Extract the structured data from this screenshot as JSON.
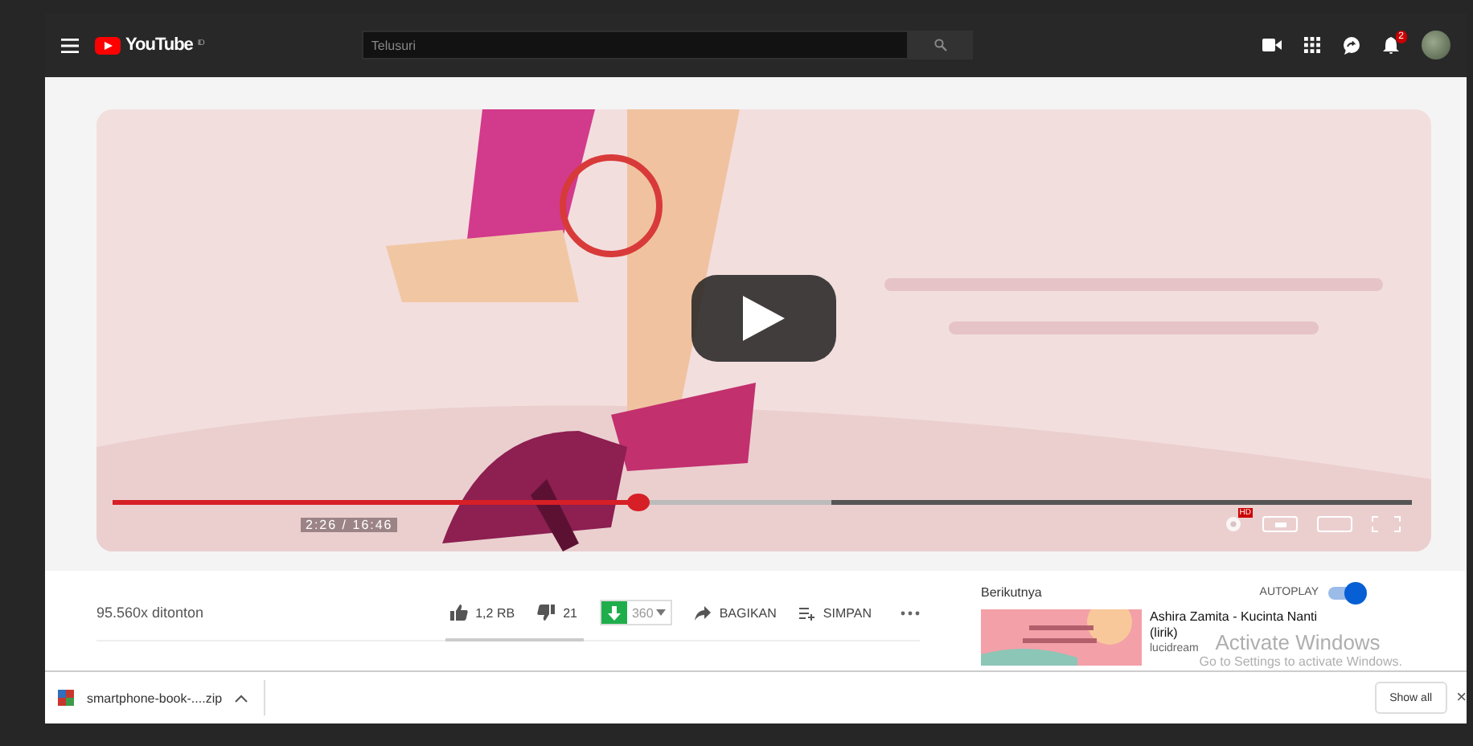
{
  "topbar": {
    "logo": "YouTube",
    "logo_region": "ID",
    "search": {
      "placeholder": "Telusuri"
    },
    "notification_count": "2"
  },
  "player": {
    "progress": {
      "level": 0.405
    },
    "buffer": {
      "level": 0.553
    },
    "time": "2:26 / 16:46",
    "quality_badge": "HD"
  },
  "info": {
    "views": "95.560x ditonton",
    "likes": "1,2 RB",
    "dislikes": "21",
    "download": {
      "quality": "360"
    },
    "actions": [
      {
        "label": "BAGIKAN",
        "kind": "share"
      },
      {
        "label": "SIMPAN",
        "kind": "save"
      }
    ]
  },
  "sidebar": {
    "heading": "Berikutnya",
    "autoplay": {
      "label": "AUTOPLAY",
      "on": true
    },
    "videos": [
      {
        "title": "Ashira Zamita - Kucinta Nanti (lirik)",
        "channel": "lucidream"
      }
    ]
  },
  "download_bar": {
    "items": [
      {
        "name": "smartphone-book-....zip"
      }
    ],
    "show_all": "Show all",
    "close": "×"
  },
  "os_overlay": {
    "title": "Activate Windows",
    "hint": "Go to Settings to activate Windows."
  }
}
